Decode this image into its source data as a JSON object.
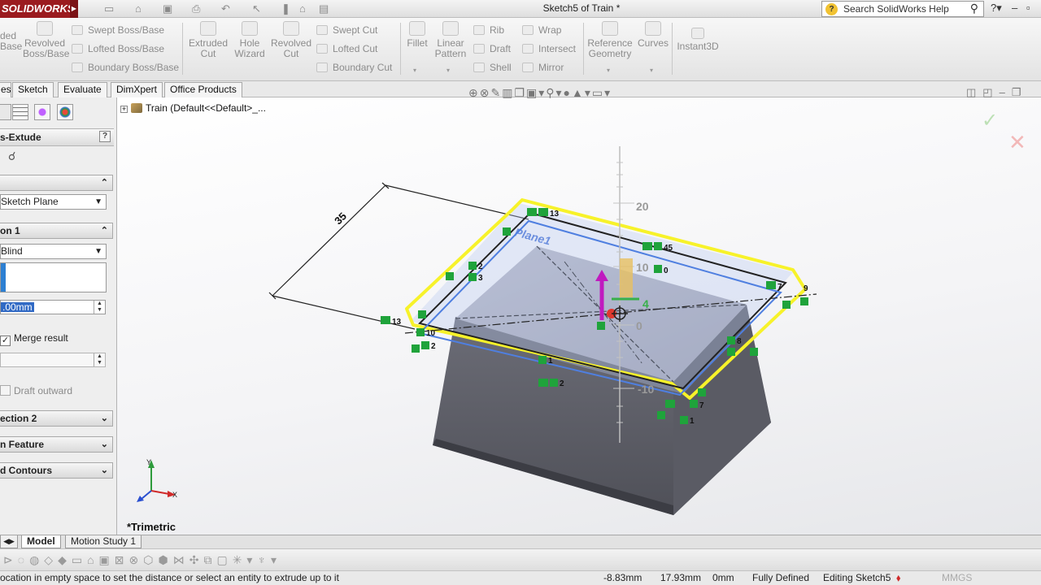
{
  "app": {
    "logo": "SOLIDWORKS",
    "title": "Sketch5 of Train *",
    "search_placeholder": "Search SolidWorks Help"
  },
  "ribbon": {
    "extruded_boss_partial": "ded\nBase",
    "revolved_boss": "Revolved\nBoss/Base",
    "swept_boss": "Swept Boss/Base",
    "lofted_boss": "Lofted Boss/Base",
    "boundary_boss": "Boundary Boss/Base",
    "extruded_cut": "Extruded\nCut",
    "hole_wizard": "Hole\nWizard",
    "revolved_cut": "Revolved\nCut",
    "swept_cut": "Swept Cut",
    "lofted_cut": "Lofted Cut",
    "boundary_cut": "Boundary Cut",
    "fillet": "Fillet",
    "linear_pattern": "Linear\nPattern",
    "rib": "Rib",
    "draft": "Draft",
    "shell": "Shell",
    "wrap": "Wrap",
    "intersect": "Intersect",
    "mirror": "Mirror",
    "reference_geometry": "Reference\nGeometry",
    "curves": "Curves",
    "instant3d": "Instant3D"
  },
  "command_tabs": [
    "es",
    "Sketch",
    "Evaluate",
    "DimXpert",
    "Office Products"
  ],
  "feature_tree": {
    "root_label": "Train  (Default<<Default>_..."
  },
  "property_manager": {
    "title": "s-Extude",
    "from_section": "",
    "from_value": "Sketch Plane",
    "direction1_label": "on 1",
    "end_condition": "Blind",
    "depth_value": ".00mm",
    "merge_result": "Merge result",
    "draft_outward": "Draft outward",
    "direction2_label": "ection 2",
    "thin_feature_label": "n Feature",
    "selected_contours_label": "d Contours"
  },
  "viewport": {
    "view_orientation": "*Trimetric",
    "plane_label": "Plane1",
    "dimension_value": "35",
    "ruler_labels": [
      "20",
      "10",
      "0",
      "-10"
    ],
    "ruler_small": "4",
    "relation_labels": [
      "13",
      "13",
      "13",
      "2",
      "3",
      "10",
      "2",
      "1",
      "2",
      "7",
      "1",
      "7",
      "3",
      "8",
      "9",
      "0",
      "45"
    ]
  },
  "bottom_tabs": {
    "model": "Model",
    "motion_study": "Motion Study 1"
  },
  "status": {
    "message": "ocation in empty space to set the distance or select an entity to extrude up to it",
    "x": "-8.83mm",
    "y": "17.93mm",
    "z": "0mm",
    "defined": "Fully Defined",
    "editing": "Editing Sketch5",
    "units": "MMGS"
  }
}
